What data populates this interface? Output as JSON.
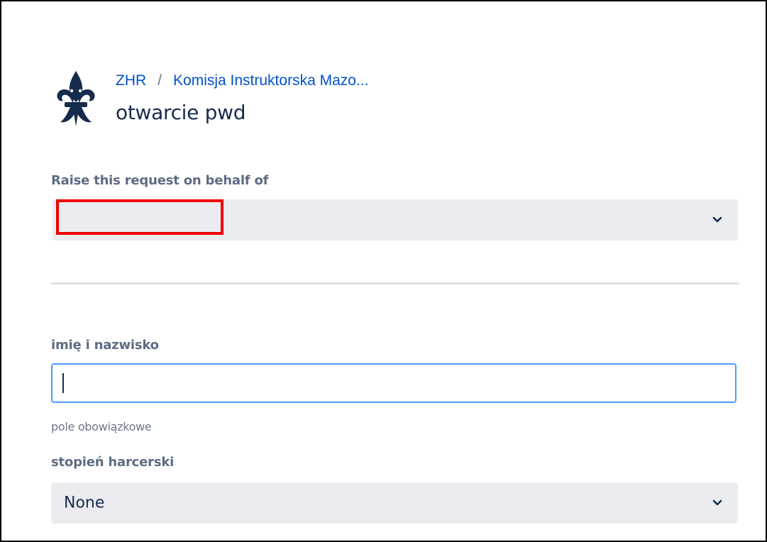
{
  "header": {
    "breadcrumb": {
      "root": "ZHR",
      "separator": "/",
      "project": "Komisja Instruktorska Mazo..."
    },
    "title": "otwarcie pwd",
    "logo_icon": "fleur-de-lis-icon"
  },
  "on_behalf": {
    "label": "Raise this request on behalf of",
    "value": "",
    "redacted": true,
    "redaction_color": "#ee0000"
  },
  "fields": {
    "name": {
      "label": "imię i nazwisko",
      "value": "",
      "helper": "pole obowiązkowe"
    },
    "rank": {
      "label": "stopień harcerski",
      "value": "None"
    }
  },
  "colors": {
    "link": "#0052cc",
    "focus_border": "#4c9aff",
    "select_bg": "#ebecf0",
    "label": "#5e6c84"
  }
}
